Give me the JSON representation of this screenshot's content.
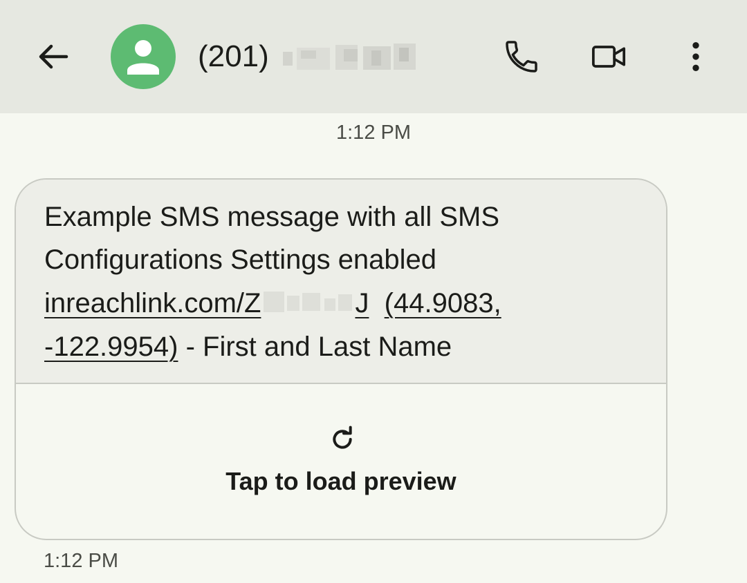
{
  "header": {
    "contact_prefix": "(201)",
    "contact_name_redacted": true,
    "icons": {
      "back": "arrow-left-icon",
      "avatar": "person-icon",
      "call": "phone-icon",
      "video": "video-camera-icon",
      "more": "more-vert-icon"
    }
  },
  "conversation": {
    "timestamp_top": "1:12 PM",
    "message": {
      "line1": "Example SMS message with all SMS",
      "line2": "Configurations Settings enabled",
      "link_prefix": "inreachlink.com/Z",
      "link_suffix": "J",
      "coords_part1": "(44.9083,",
      "coords_part2": "-122.9954)",
      "trailing_text": " - First and Last Name"
    },
    "preview": {
      "icon": "refresh-icon",
      "label": "Tap to load preview"
    },
    "timestamp_bottom": "1:12 PM"
  },
  "colors": {
    "appbar_bg": "#e6e8e1",
    "screen_bg": "#f6f8f1",
    "bubble_bg": "#edeee8",
    "avatar_bg": "#5dbb72",
    "text": "#1b1c19"
  }
}
